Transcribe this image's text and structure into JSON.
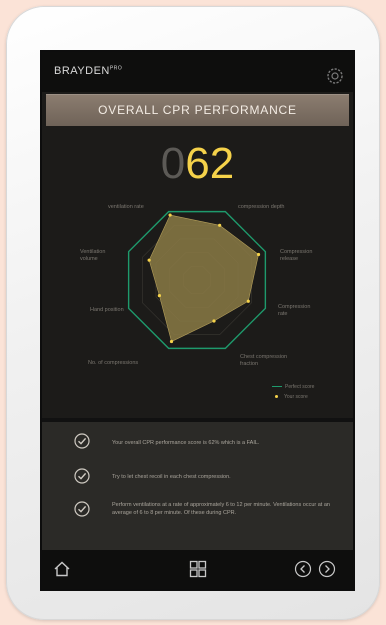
{
  "app": {
    "logo": "BRAYDEN",
    "logo_mark": "PRO"
  },
  "header": {
    "title": "OVERALL CPR PERFORMANCE"
  },
  "score": {
    "leading": "0",
    "value": "62"
  },
  "radar": {
    "axes": [
      "ventilation rate",
      "compression depth",
      "Compression release",
      "Compression rate",
      "Chest compression fraction",
      "No. of compressions",
      "Hand position",
      "Ventilation volume"
    ],
    "performance": [
      0.95,
      0.8,
      0.9,
      0.75,
      0.6,
      0.9,
      0.55,
      0.7
    ],
    "colors": {
      "target": "#1e9a6c",
      "fill": "#8a7a45",
      "point": "#f5d24a"
    }
  },
  "legend": {
    "target": "Perfect score",
    "actual": "Your score"
  },
  "notes": [
    "Your overall CPR performance score is 62% which is a FAIL.",
    "Try to let chest recoil in each chest compression.",
    "Perform ventilations at a rate of approximately 6 to 12 per minute. Ventilations occur at an average of 6 to 8 per minute. Of these during CPR."
  ],
  "icons": {
    "settings": "gear-icon",
    "home": "home-icon",
    "menu": "grid-icon",
    "prev": "chevron-left-icon",
    "next": "chevron-right-icon",
    "check": "check-circle-icon"
  }
}
